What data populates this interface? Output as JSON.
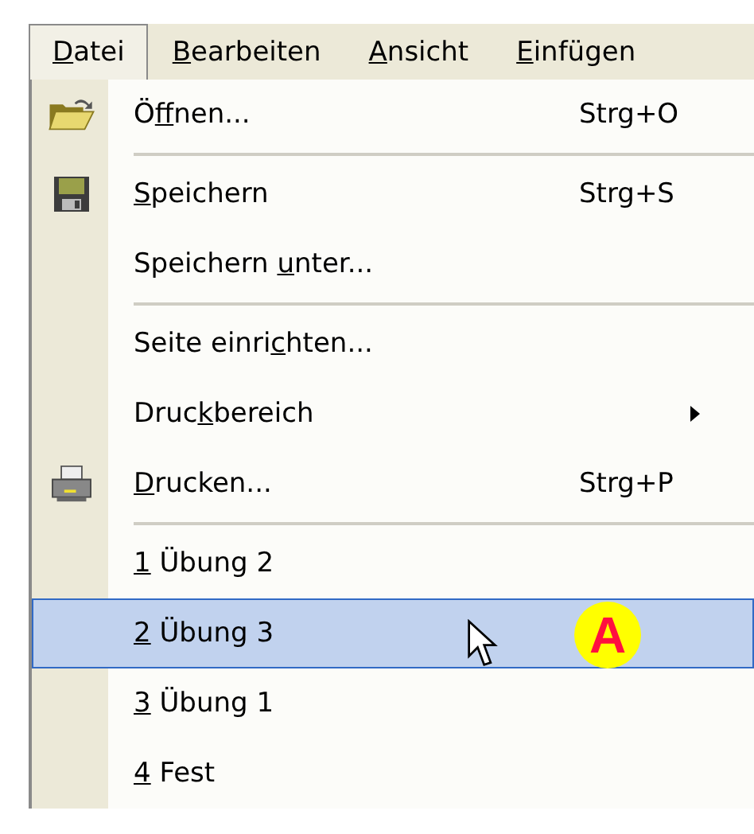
{
  "menubar": [
    {
      "key": "D",
      "after": "atei",
      "selected": true
    },
    {
      "key": "B",
      "after": "earbeiten",
      "selected": false
    },
    {
      "key": "A",
      "after": "nsicht",
      "selected": false
    },
    {
      "key": "E",
      "after": "infügen",
      "selected": false
    }
  ],
  "menu": [
    {
      "kind": "item",
      "before": "Ö",
      "key": "f",
      "after": "fnen...",
      "shortcut": "Strg+O",
      "selected": false
    },
    {
      "kind": "separator"
    },
    {
      "kind": "item",
      "key": "S",
      "after": "peichern",
      "shortcut": "Strg+S",
      "selected": false
    },
    {
      "kind": "item",
      "before": "Speichern ",
      "key": "u",
      "after": "nter...",
      "selected": false
    },
    {
      "kind": "separator"
    },
    {
      "kind": "item",
      "before": "Seite einri",
      "key": "c",
      "after": "hten...",
      "selected": false
    },
    {
      "kind": "item",
      "before": "Druc",
      "key": "k",
      "after": "bereich",
      "submenu": true,
      "selected": false
    },
    {
      "kind": "item",
      "key": "D",
      "after": "rucken...",
      "shortcut": "Strg+P",
      "selected": false
    },
    {
      "kind": "separator"
    },
    {
      "kind": "item",
      "key": "1",
      "after": " Übung 2",
      "selected": false
    },
    {
      "kind": "item",
      "key": "2",
      "after": " Übung 3",
      "selected": true
    },
    {
      "kind": "item",
      "key": "3",
      "after": " Übung 1",
      "selected": false
    },
    {
      "kind": "item",
      "key": "4",
      "after": " Fest",
      "selected": false
    }
  ],
  "annotation": {
    "label": "A"
  }
}
